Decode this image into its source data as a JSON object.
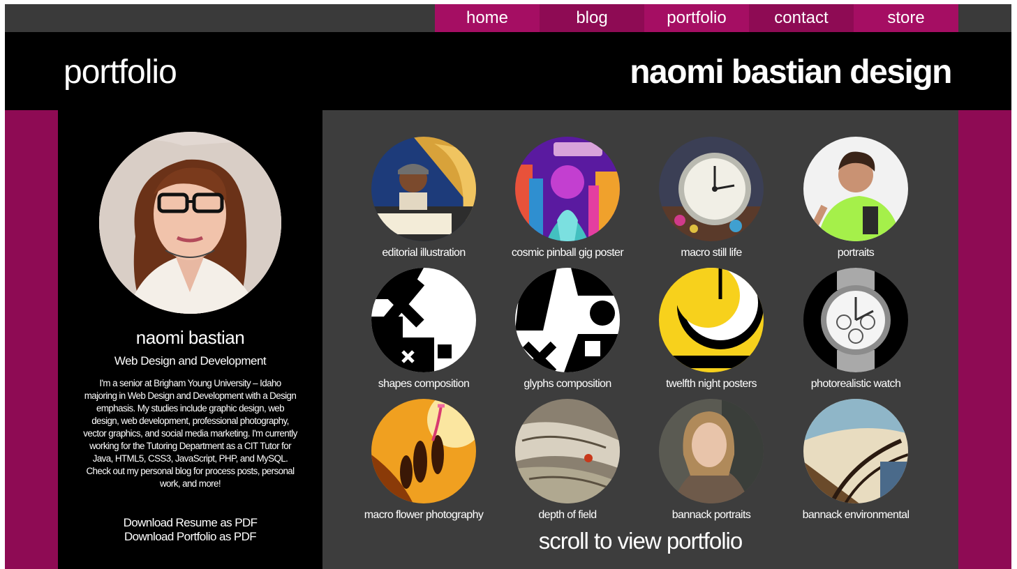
{
  "nav": {
    "items": [
      {
        "label": "home"
      },
      {
        "label": "blog"
      },
      {
        "label": "portfolio"
      },
      {
        "label": "contact"
      },
      {
        "label": "store"
      }
    ]
  },
  "header": {
    "page_heading": "portfolio",
    "site_title": "naomi bastian design"
  },
  "profile": {
    "name": "naomi bastian",
    "role": "Web Design and Development",
    "bio": "I'm a senior at Brigham Young University – Idaho majoring in Web Design and Development with a Design emphasis. My studies include graphic design, web design, web development, professional photography, vector graphics, and social media marketing. I'm currently working for the Tutoring Department as a CIT Tutor for Java, HTML5, CSS3, JavaScript, PHP, and MySQL. Check out my personal blog for process posts, personal work, and more!",
    "download_resume": "Download Resume as PDF",
    "download_portfolio": "Download Portfolio as PDF"
  },
  "gallery": {
    "items": [
      {
        "caption": "editorial illustration"
      },
      {
        "caption": "cosmic pinball gig poster"
      },
      {
        "caption": "macro still life"
      },
      {
        "caption": "portraits"
      },
      {
        "caption": "shapes composition"
      },
      {
        "caption": "glyphs composition"
      },
      {
        "caption": "twelfth night posters"
      },
      {
        "caption": "photorealistic watch"
      },
      {
        "caption": "macro flower photography"
      },
      {
        "caption": "depth of field"
      },
      {
        "caption": "bannack portraits"
      },
      {
        "caption": "bannack environmental"
      }
    ],
    "scroll_hint": "scroll to view portfolio"
  },
  "colors": {
    "accent": "#a50e63",
    "accent_dark": "#8e0b54",
    "topbar": "#3a3a3a",
    "gallery_bg": "#3d3d3d"
  }
}
